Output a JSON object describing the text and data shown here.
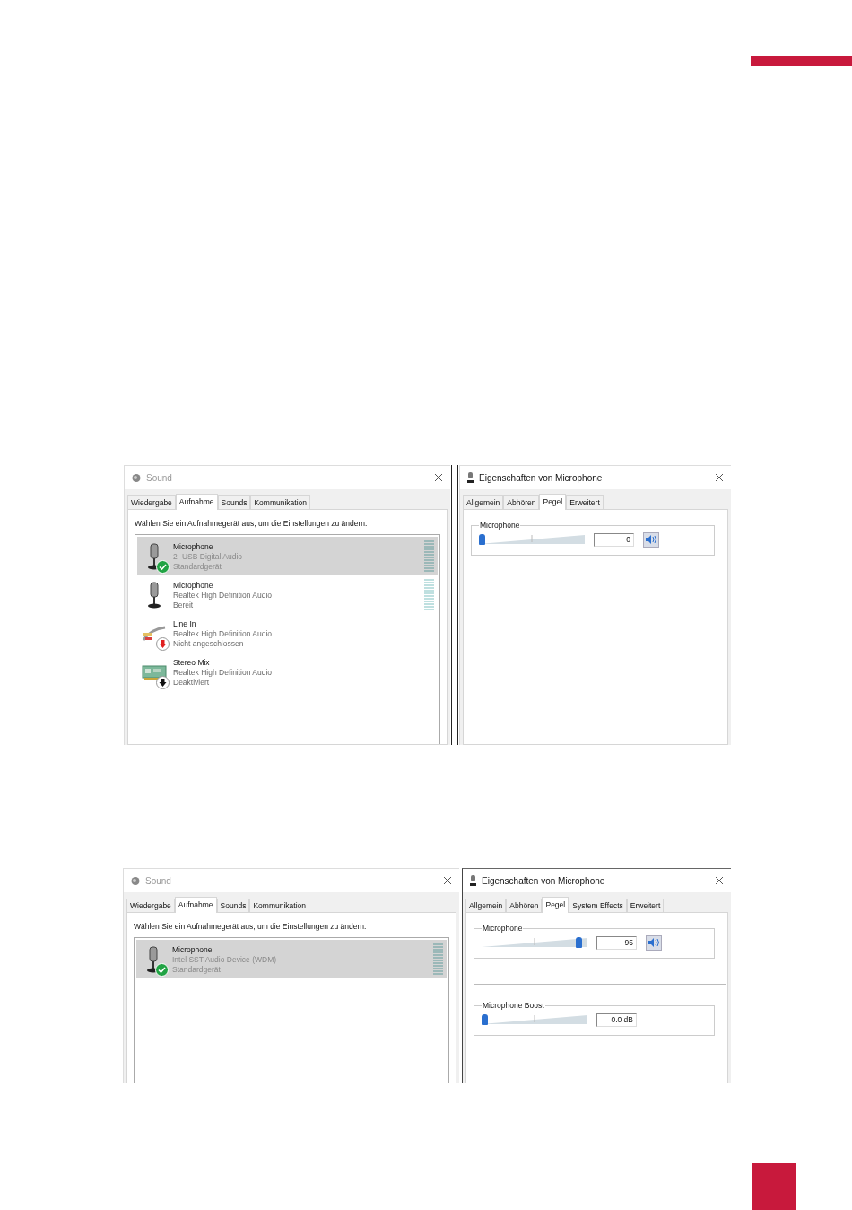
{
  "screenshots": [
    {
      "sound_window": {
        "title": "Sound",
        "tabs": [
          {
            "label": "Wiedergabe",
            "selected": false
          },
          {
            "label": "Aufnahme",
            "selected": true
          },
          {
            "label": "Sounds",
            "selected": false
          },
          {
            "label": "Kommunikation",
            "selected": false
          }
        ],
        "instruction": "Wählen Sie ein Aufnahmegerät aus, um die Einstellungen zu ändern:",
        "devices": [
          {
            "kind": "default_microphone",
            "name": "Microphone",
            "driver": "2- USB Digital Audio",
            "status": "Standardgerät",
            "meter": true,
            "selected": true
          },
          {
            "kind": "microphone",
            "name": "Microphone",
            "driver": "Realtek High Definition Audio",
            "status": "Bereit",
            "meter": true,
            "selected": false
          },
          {
            "kind": "unplugged_line",
            "name": "Line In",
            "driver": "Realtek High Definition Audio",
            "status": "Nicht angeschlossen",
            "meter": false,
            "selected": false
          },
          {
            "kind": "disabled_mix",
            "name": "Stereo Mix",
            "driver": "Realtek High Definition Audio",
            "status": "Deaktiviert",
            "meter": false,
            "selected": false
          }
        ]
      },
      "properties_window": {
        "title": "Eigenschaften von Microphone",
        "tabs": [
          {
            "label": "Allgemein",
            "selected": false
          },
          {
            "label": "Abhören",
            "selected": false
          },
          {
            "label": "Pegel",
            "selected": true
          },
          {
            "label": "Erweitert",
            "selected": false
          }
        ],
        "groups": [
          {
            "label": "Microphone",
            "level": 0,
            "value": "0",
            "mute_button": true
          }
        ]
      }
    },
    {
      "sound_window": {
        "title": "Sound",
        "tabs": [
          {
            "label": "Wiedergabe",
            "selected": false
          },
          {
            "label": "Aufnahme",
            "selected": true
          },
          {
            "label": "Sounds",
            "selected": false
          },
          {
            "label": "Kommunikation",
            "selected": false
          }
        ],
        "instruction": "Wählen Sie ein Aufnahmegerät aus, um die Einstellungen zu ändern:",
        "devices": [
          {
            "kind": "default_microphone",
            "name": "Microphone",
            "driver": "Intel SST Audio Device (WDM)",
            "status": "Standardgerät",
            "meter": true,
            "selected": true
          }
        ]
      },
      "properties_window": {
        "title": "Eigenschaften von Microphone",
        "tabs": [
          {
            "label": "Allgemein",
            "selected": false
          },
          {
            "label": "Abhören",
            "selected": false
          },
          {
            "label": "Pegel",
            "selected": true
          },
          {
            "label": "System Effects",
            "selected": false
          },
          {
            "label": "Erweitert",
            "selected": false
          }
        ],
        "groups": [
          {
            "label": "Microphone",
            "level": 0.95,
            "value": "95",
            "mute_button": true
          },
          {
            "label": "Microphone Boost",
            "level": 0,
            "value": "0.0 dB",
            "mute_button": false
          }
        ]
      }
    }
  ]
}
